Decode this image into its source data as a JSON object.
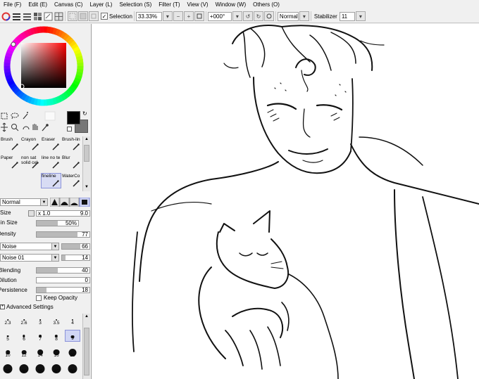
{
  "menu": [
    "File (F)",
    "Edit (E)",
    "Canvas (C)",
    "Layer (L)",
    "Selection (S)",
    "Filter (T)",
    "View (V)",
    "Window (W)",
    "Others (O)"
  ],
  "toolbar": {
    "selection_label": "Selection",
    "zoom": "33.33%",
    "rotation": "+000°",
    "blend_mode": "Normal",
    "stabilizer_label": "Stabilizer",
    "stabilizer_value": "11"
  },
  "colors": {
    "primary": "#000000",
    "secondary": "#777777"
  },
  "brushes": [
    {
      "label": "Brush"
    },
    {
      "label": "Crayon"
    },
    {
      "label": "Eraser"
    },
    {
      "label": "Brush-lin"
    },
    {
      "label": "Paper"
    },
    {
      "label": "non sat solid cel"
    },
    {
      "label": "line no te"
    },
    {
      "label": "Blur"
    },
    {
      "label": ""
    },
    {
      "label": ""
    },
    {
      "label": "fineline"
    },
    {
      "label": "WaterCo"
    }
  ],
  "brush_settings": {
    "mode": "Normal",
    "size_label": "Size",
    "size_multiplier": "x 1.0",
    "size_value": "9.0",
    "min_size_label": "Min Size",
    "min_size_value": "50%",
    "min_size_fraction": 0.5,
    "density_label": "Density",
    "density_value": "77",
    "density_fraction": 0.77,
    "texture_mode": "Noise",
    "texture_value": "66",
    "texture_fraction": 0.66,
    "texture_name": "Noise 01",
    "texture_strength": "14",
    "texture_strength_fraction": 0.14,
    "blending_label": "Blending",
    "blending_value": "40",
    "blending_fraction": 0.4,
    "dilution_label": "Dilution",
    "dilution_value": "0",
    "dilution_fraction": 0.0,
    "persistence_label": "Persistence",
    "persistence_value": "18",
    "persistence_fraction": 0.18,
    "keep_opacity_label": "Keep Opacity",
    "advanced_label": "Advanced Settings"
  },
  "brush_sizes": [
    "2.3",
    "2.6",
    "3",
    "3.5",
    "4",
    "5",
    "6",
    "7",
    "8",
    "9",
    "10",
    "12",
    "14",
    "16",
    "20",
    "25",
    "30",
    "35",
    "40",
    "50"
  ],
  "selected_size": "9"
}
